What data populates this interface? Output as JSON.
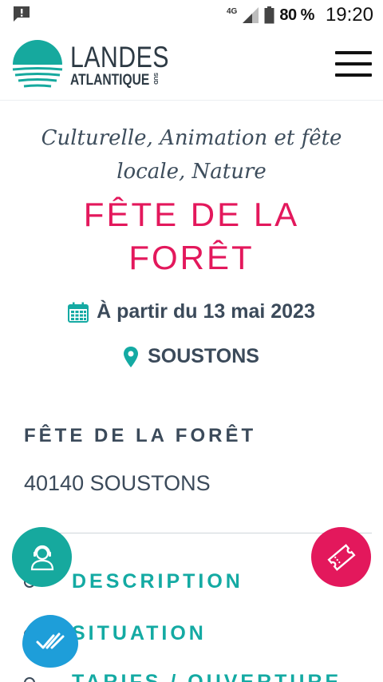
{
  "status_bar": {
    "network": "4G",
    "battery": "80 %",
    "time": "19:20"
  },
  "header": {
    "logo_line1": "LANDES",
    "logo_line2": "ATLANTIQUE",
    "logo_sud": "SUD",
    "menu_icon": "hamburger-menu-icon"
  },
  "event": {
    "categories": "Culturelle, Animation et fête locale, Nature",
    "title_line1": "FÊTE DE LA",
    "title_line2": "FORÊT",
    "date": "À partir du 13 mai 2023",
    "location": "SOUSTONS"
  },
  "place": {
    "name": "FÊTE DE LA FORÊT",
    "address": "40140 SOUSTONS"
  },
  "sections": [
    {
      "label": "DESCRIPTION"
    },
    {
      "label": "SITUATION"
    },
    {
      "label": "TARIFS / OUVERTURE"
    }
  ],
  "colors": {
    "accent_pink": "#e3185c",
    "accent_teal": "#14aaa3",
    "fab_blue": "#1e9ed9",
    "text_dark": "#3b4a5a"
  },
  "icons": {
    "contact": "headset-user-icon",
    "ticket": "ticket-icon",
    "check": "double-check-icon",
    "calendar": "calendar-icon",
    "pin": "map-pin-icon"
  }
}
